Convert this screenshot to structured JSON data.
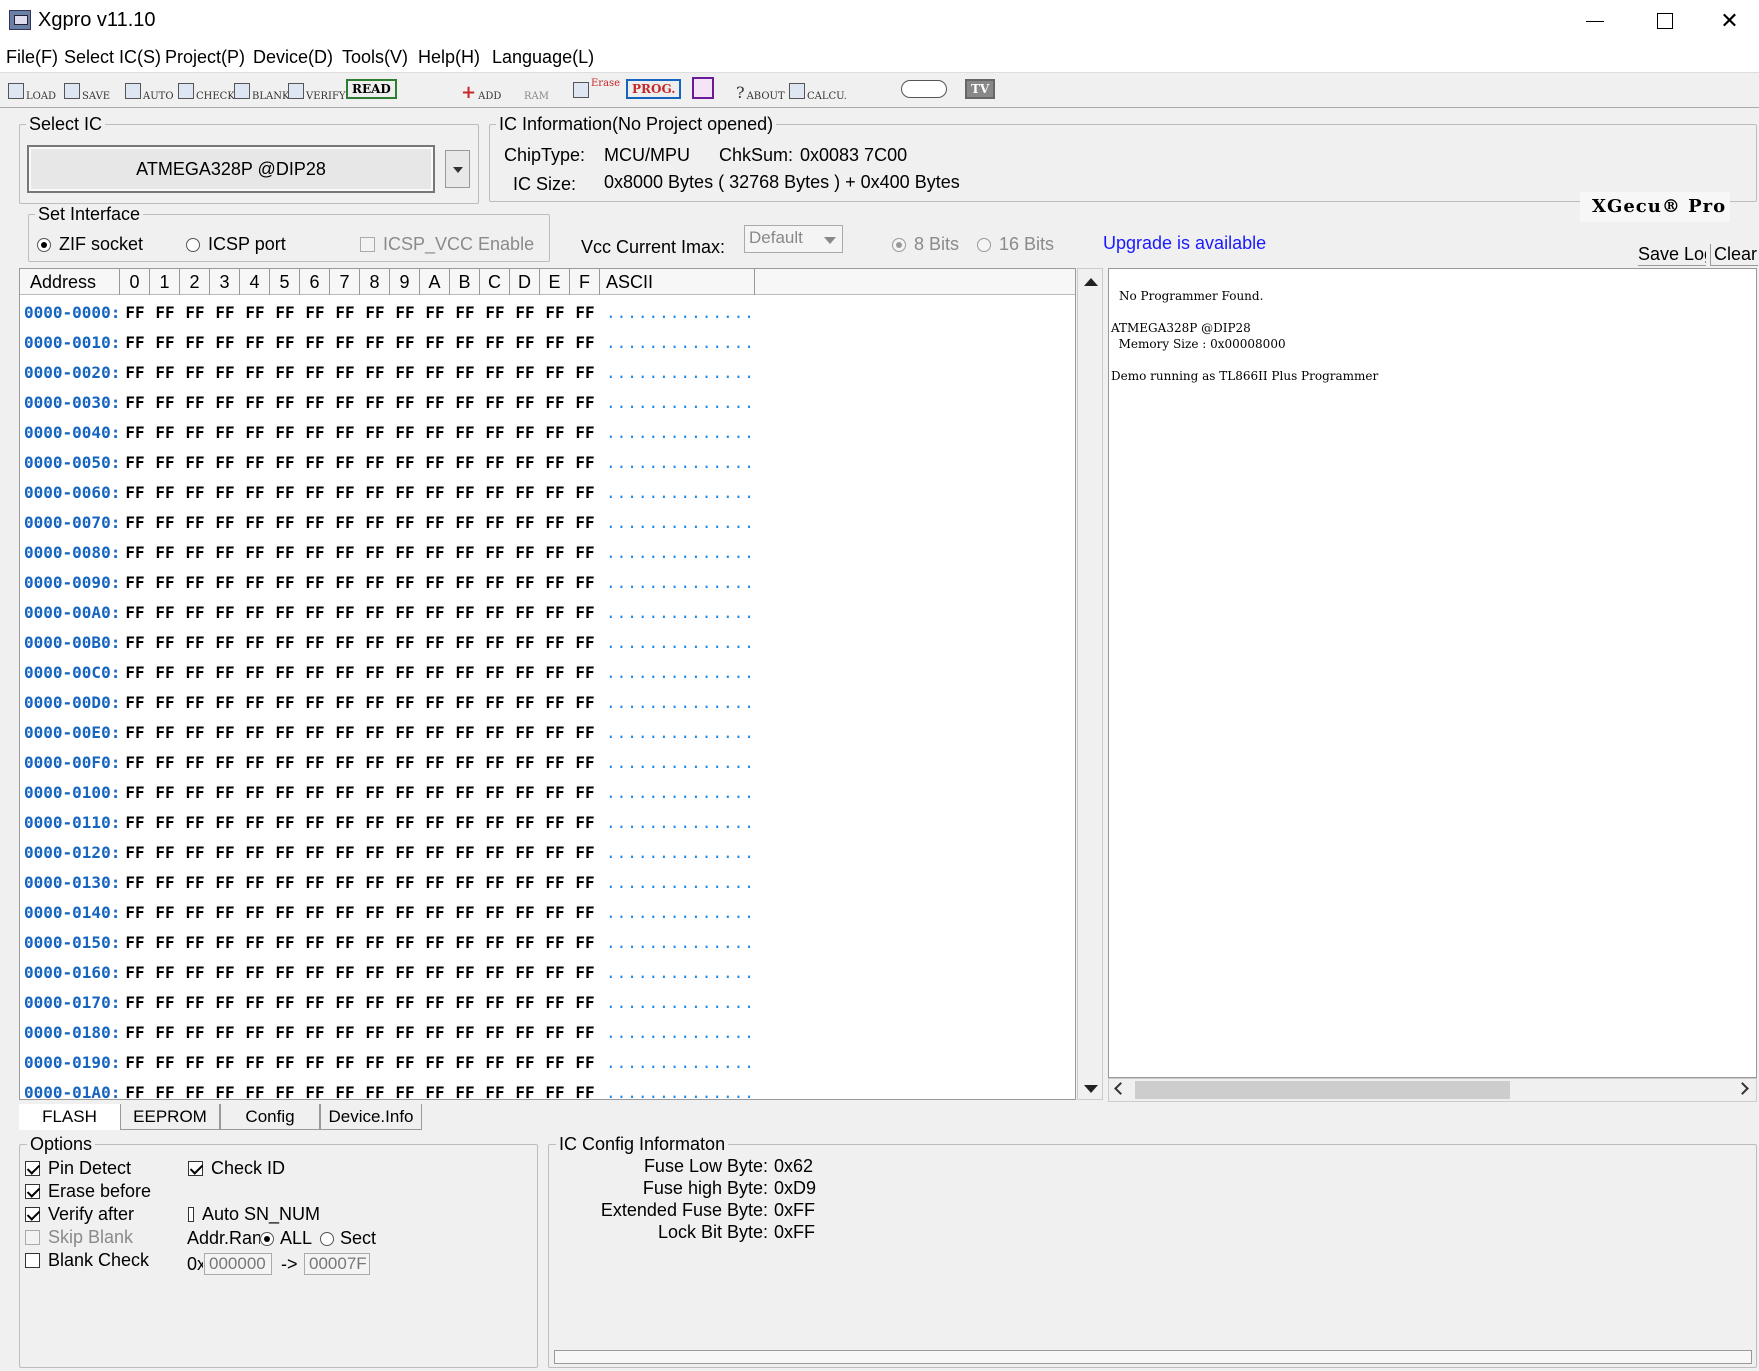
{
  "window": {
    "title": "Xgpro v11.10",
    "minimize": "—",
    "maximize": "☐",
    "close": "✕"
  },
  "menu": [
    "File(F)",
    "Select IC(S)",
    "Project(P)",
    "Device(D)",
    "Tools(V)",
    "Help(H)",
    "Language(L)"
  ],
  "toolbar": {
    "load": "LOAD",
    "save": "SAVE",
    "auto": "AUTO",
    "check": "CHECK",
    "blank": "BLANK",
    "verify": "VERIFY",
    "read": "READ",
    "add": "ADD",
    "ram": "RAM",
    "erase": "Erase",
    "prog": "PROG.",
    "about": "ABOUT",
    "calcu": "CALCU.",
    "tv": "TV"
  },
  "select_ic": {
    "label": "Select IC",
    "value": "ATMEGA328P @DIP28"
  },
  "ic_info": {
    "label": "IC Information(No Project opened)",
    "chiptype_label": "ChipType:",
    "chiptype": "MCU/MPU",
    "chksum_label": "ChkSum:",
    "chksum": "0x0083 7C00",
    "icsize_label": "IC Size:",
    "icsize": "0x8000 Bytes ( 32768 Bytes ) + 0x400 Bytes"
  },
  "brand": "XGecu® Pro",
  "interface": {
    "label": "Set Interface",
    "zif": "ZIF socket",
    "icsp": "ICSP port",
    "icsp_vcc": "ICSP_VCC Enable"
  },
  "vcc": {
    "label": "Vcc Current Imax:",
    "value": "Default"
  },
  "bits": {
    "b8": "8 Bits",
    "b16": "16 Bits"
  },
  "upgrade": "Upgrade is available",
  "log_buttons": {
    "save": "Save Log",
    "clear": "Clear"
  },
  "hex": {
    "headers": [
      "Address",
      "0",
      "1",
      "2",
      "3",
      "4",
      "5",
      "6",
      "7",
      "8",
      "9",
      "A",
      "B",
      "C",
      "D",
      "E",
      "F",
      "ASCII"
    ],
    "addresses": [
      "0000-0000:",
      "0000-0010:",
      "0000-0020:",
      "0000-0030:",
      "0000-0040:",
      "0000-0050:",
      "0000-0060:",
      "0000-0070:",
      "0000-0080:",
      "0000-0090:",
      "0000-00A0:",
      "0000-00B0:",
      "0000-00C0:",
      "0000-00D0:",
      "0000-00E0:",
      "0000-00F0:",
      "0000-0100:",
      "0000-0110:",
      "0000-0120:",
      "0000-0130:",
      "0000-0140:",
      "0000-0150:",
      "0000-0160:",
      "0000-0170:",
      "0000-0180:",
      "0000-0190:",
      "0000-01A0:"
    ],
    "byte": "FF",
    "ascii": "................"
  },
  "log": [
    "No Programmer Found.",
    "",
    "ATMEGA328P @DIP28",
    "  Memory Size : 0x00008000",
    "",
    "Demo running as TL866II Plus Programmer"
  ],
  "tabs": [
    "FLASH",
    "EEPROM",
    "Config",
    "Device.Info"
  ],
  "options": {
    "label": "Options",
    "pin_detect": "Pin Detect",
    "erase_before": "Erase before",
    "verify_after": "Verify after",
    "skip_blank": "Skip Blank",
    "blank_check": "Blank Check",
    "check_id": "Check ID",
    "auto_sn": "Auto SN_NUM",
    "addr_range": "Addr.Range",
    "all": "ALL",
    "sect": "Sect",
    "hex_prefix": "0x",
    "from": "000000",
    "arrow": "->",
    "to": "00007F"
  },
  "ic_config": {
    "label": "IC Config Informaton",
    "rows": [
      {
        "k": "Fuse Low Byte:",
        "v": "0x62"
      },
      {
        "k": "Fuse high Byte:",
        "v": "0xD9"
      },
      {
        "k": "Extended Fuse Byte:",
        "v": "0xFF"
      },
      {
        "k": "Lock Bit Byte:",
        "v": "0xFF"
      }
    ]
  }
}
